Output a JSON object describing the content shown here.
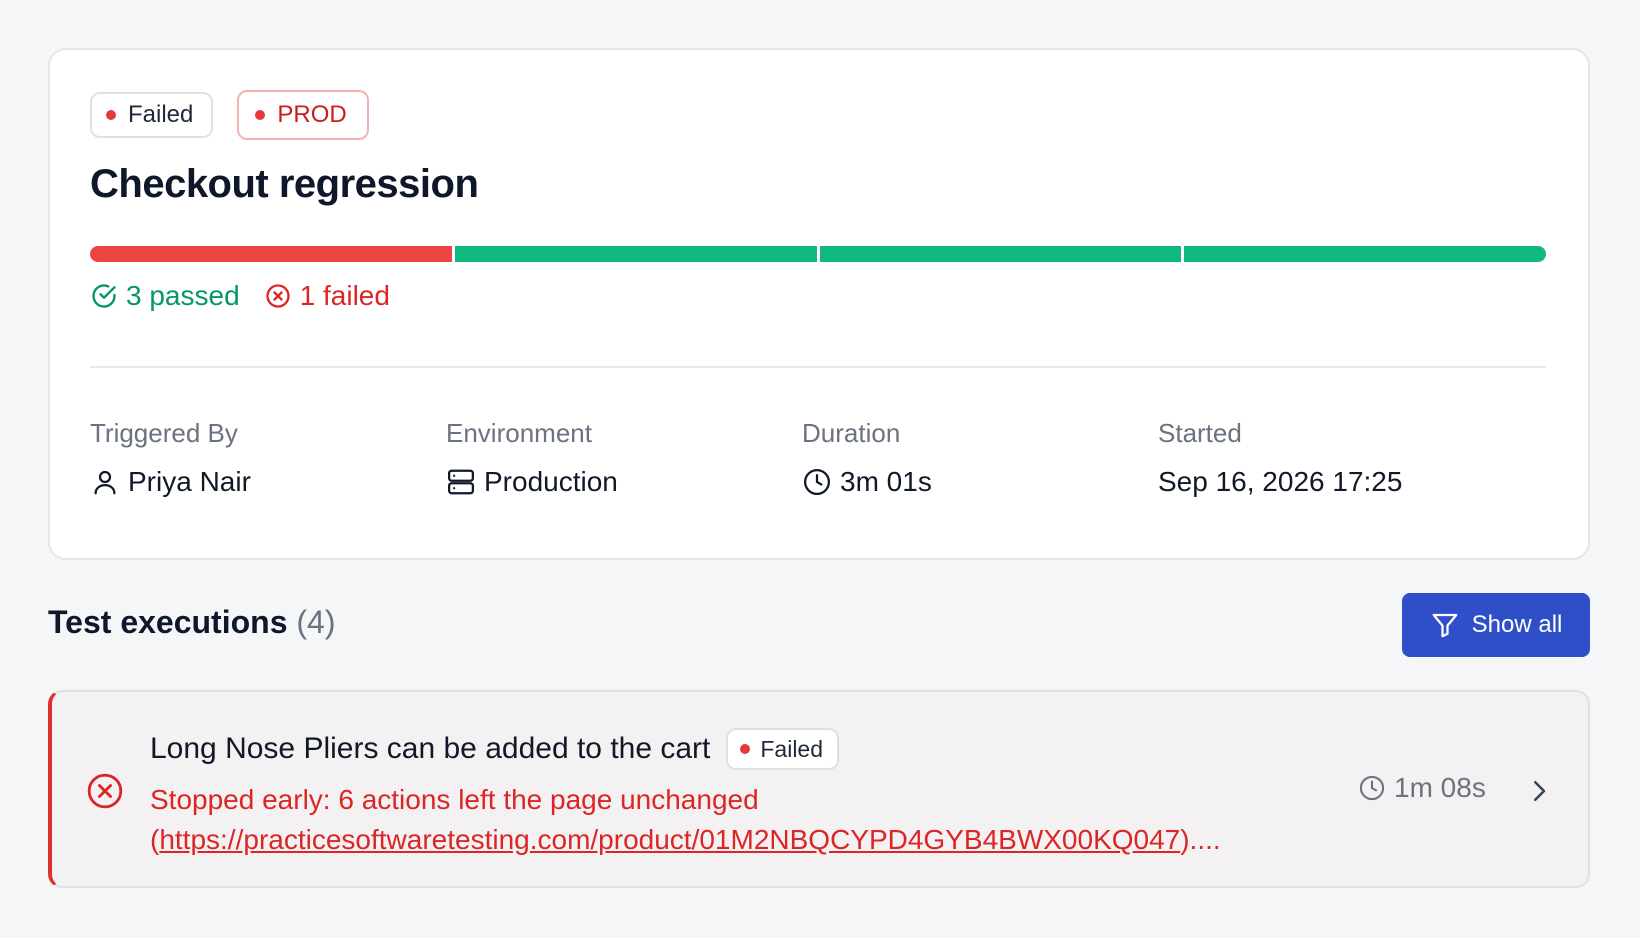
{
  "run": {
    "status_badge": "Failed",
    "env_badge": "PROD",
    "title": "Checkout regression",
    "progress": {
      "passed": 3,
      "failed": 1,
      "total": 4
    },
    "passed_label": "3 passed",
    "failed_label": "1 failed",
    "meta": {
      "triggered_by": {
        "label": "Triggered By",
        "value": "Priya Nair",
        "icon": "user-icon"
      },
      "environment": {
        "label": "Environment",
        "value": "Production",
        "icon": "server-icon"
      },
      "duration": {
        "label": "Duration",
        "value": "3m 01s",
        "icon": "clock-icon"
      },
      "started": {
        "label": "Started",
        "value": "Sep 16, 2026 17:25"
      }
    }
  },
  "executions": {
    "title": "Test executions",
    "count": "(4)",
    "show_all_label": "Show all",
    "items": [
      {
        "title": "Long Nose Pliers can be added to the cart",
        "status_badge": "Failed",
        "message_prefix": "Stopped early: 6 actions left the page unchanged",
        "message_open": "(",
        "message_link": "https://practicesoftwaretesting.com/product/01M2NBQCYPD4GYB4BWX00KQ047",
        "message_suffix": ")....",
        "duration": "1m 08s"
      }
    ]
  },
  "colors": {
    "fail": "#ef4444",
    "pass": "#10b981",
    "primary_button": "#2e4fc8"
  }
}
